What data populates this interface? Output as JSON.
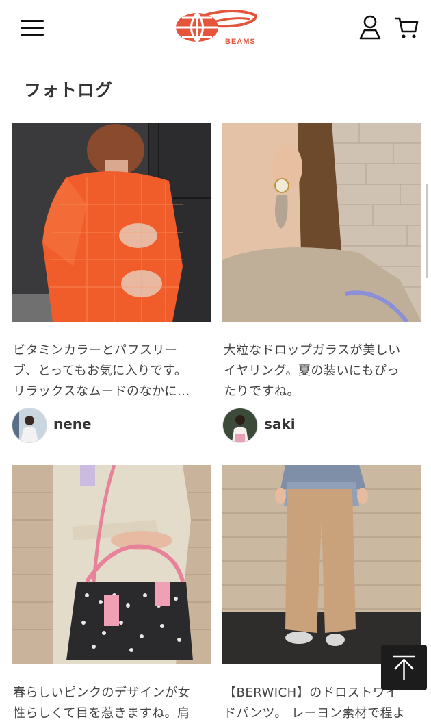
{
  "header": {
    "menu_icon": "hamburger-menu-icon",
    "logo_text": "BEAMS",
    "account_icon": "user-icon",
    "cart_icon": "shopping-cart-icon",
    "brand_color": "#e5553c"
  },
  "section": {
    "title": "フォトログ"
  },
  "posts": [
    {
      "caption_lines": [
        "ビタミンカラーとパフスリー",
        "ブ、とってもお気に入りです。",
        "リラックスなムードのなかに..."
      ],
      "author": "nene"
    },
    {
      "caption_lines": [
        "大粒なドロップガラスが美しい",
        "イヤリング。夏の装いにもぴっ",
        "たりですね。"
      ],
      "author": "saki"
    },
    {
      "caption_lines": [
        "春らしいピンクのデザインが女",
        "性らしくて目を惹きますね。肩"
      ]
    },
    {
      "caption_lines": [
        "【BERWICH】のドロストワイ",
        "ドパンツ。 レーヨン素材で程よ"
      ]
    }
  ],
  "back_to_top_icon": "arrow-up-icon"
}
